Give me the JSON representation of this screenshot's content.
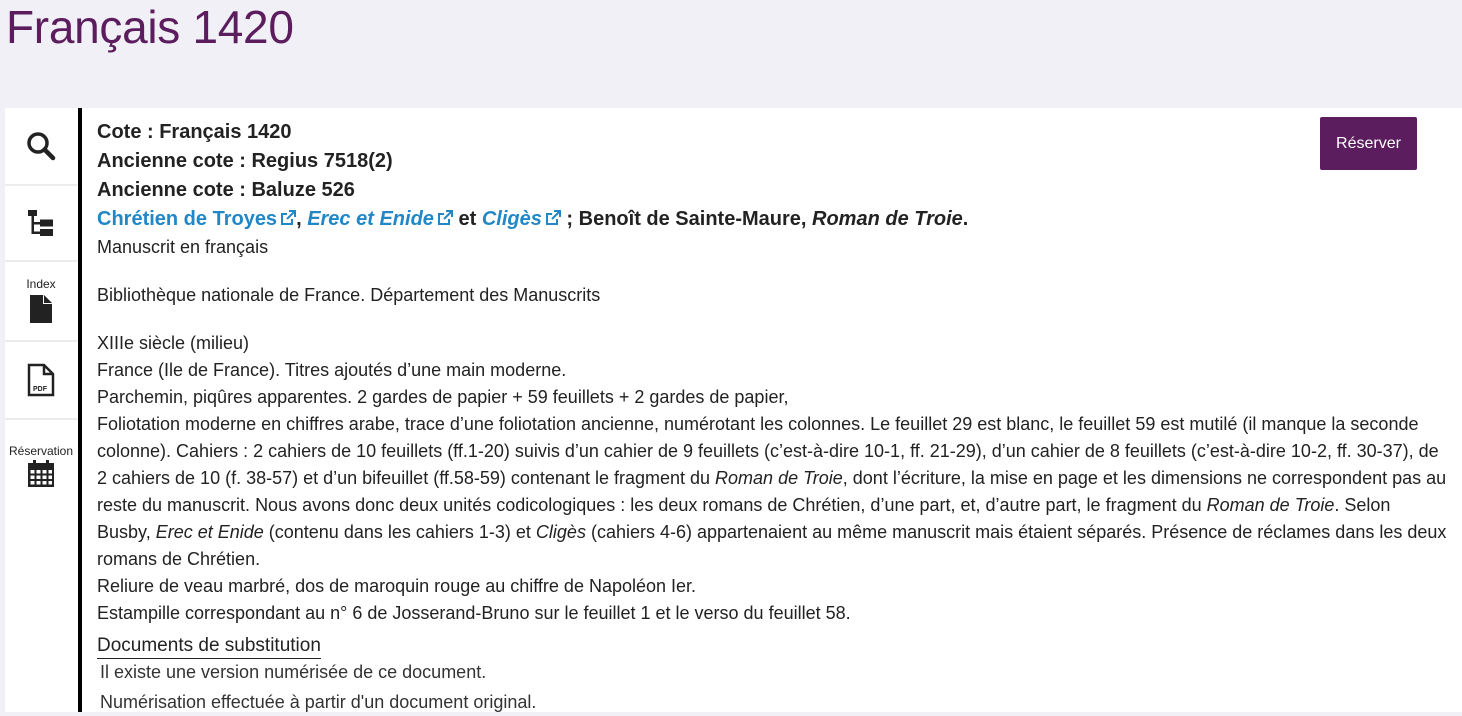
{
  "page": {
    "title": "Français 1420"
  },
  "toolbar": {
    "index_label": "Index",
    "reservation_label": "Réservation",
    "pdf_icon_text": "PDF"
  },
  "record": {
    "cote": "Cote : Français 1420",
    "ancienne_cote_1": "Ancienne cote : Regius 7518(2)",
    "ancienne_cote_2": "Ancienne cote : Baluze 526",
    "title_line": {
      "author_link": "Chrétien de Troyes",
      "sep1": ",",
      "work1_link": "Erec et Enide",
      "et": "et",
      "work2_link": "Cligès",
      "rest_plain": "; Benoît de Sainte-Maure,",
      "rest_italic": "Roman de Troie",
      "rest_end": "."
    },
    "language": "Manuscrit en français",
    "institution": "Bibliothèque nationale de France. Département des Manuscrits",
    "date": "XIIIe siècle (milieu)",
    "origin": "France (Ile de France). Titres ajoutés d’une main moderne.",
    "support": "Parchemin, piqûres apparentes. 2 gardes de papier + 59 feuillets + 2 gardes de papier,",
    "collation": {
      "p1": "Foliotation moderne en chiffres arabe, trace d’une foliotation ancienne, numérotant les colonnes. Le feuillet 29 est blanc, le feuillet 59 est mutilé (il manque la seconde colonne). Cahiers : 2 cahiers de 10 feuillets (ff.1-20) suivis d’un cahier de 9 feuillets (c’est-à-dire 10-1, ff. 21-29), d’un cahier de 8 feuillets (c’est-à-dire 10-2, ff. 30-37), de 2 cahiers de 10 (f. 38-57) et d’un bifeuillet (ff.58-59) contenant le fragment du ",
      "i1": "Roman de Troie",
      "p2": ", dont l’écriture, la mise en page et les dimensions ne correspondent pas au reste du manuscrit. Nous avons donc deux unités codicologiques : les deux romans de Chrétien, d’une part, et, d’autre part, le fragment du ",
      "i2": "Roman de Troie",
      "p3": ". Selon Busby, ",
      "i3": "Erec et Enide",
      "p4": " (contenu dans les cahiers 1-3) et ",
      "i4": "Cligès",
      "p5": " (cahiers 4-6) appartenaient au même manuscrit mais étaient séparés. Présence de réclames dans les deux romans de Chrétien."
    },
    "binding": "Reliure de veau marbré, dos de maroquin rouge au chiffre de Napoléon Ier.",
    "stamp": "Estampille correspondant au n° 6 de Josserand-Bruno sur le feuillet 1 et le verso du feuillet 58.",
    "substitution": {
      "title": "Documents de substitution",
      "line1": "Il existe une version numérisée de ce document.",
      "line2": "Numérisation effectuée à partir d'un document original."
    }
  },
  "actions": {
    "reserve_label": "Réserver"
  },
  "colors": {
    "brand": "#5c1d5f",
    "link": "#2187c7",
    "background": "#f1f0f6"
  }
}
